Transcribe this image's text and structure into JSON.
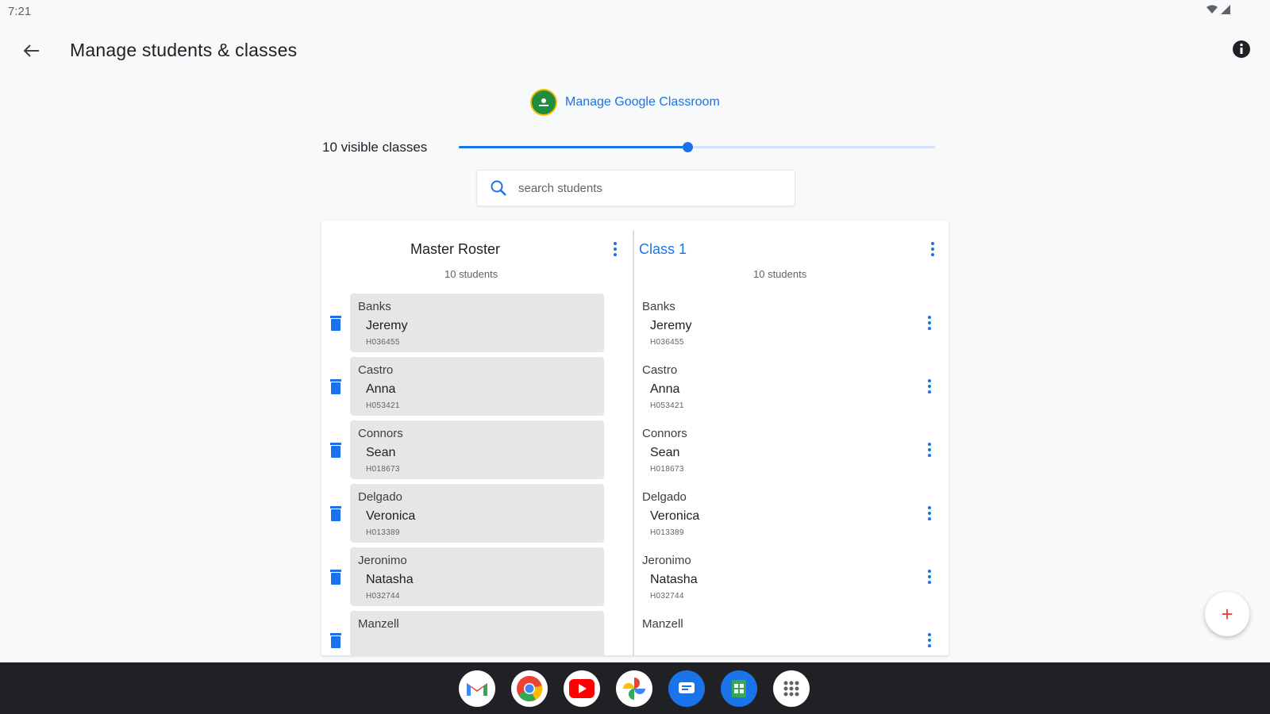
{
  "status_bar": {
    "time": "7:21"
  },
  "app_bar": {
    "title": "Manage students & classes"
  },
  "google_classroom": {
    "link_label": "Manage Google Classroom"
  },
  "visible_classes": {
    "label": "10 visible classes",
    "slider_fraction": 0.48
  },
  "search": {
    "placeholder": "search students",
    "value": ""
  },
  "master_roster": {
    "title": "Master Roster",
    "count": "10 students",
    "students": [
      {
        "last": "Banks",
        "first": "Jeremy",
        "id": "H036455"
      },
      {
        "last": "Castro",
        "first": "Anna",
        "id": "H053421"
      },
      {
        "last": "Connors",
        "first": "Sean",
        "id": "H018673"
      },
      {
        "last": "Delgado",
        "first": "Veronica",
        "id": "H013389"
      },
      {
        "last": "Jeronimo",
        "first": "Natasha",
        "id": "H032744"
      },
      {
        "last": "Manzell",
        "first": "",
        "id": ""
      }
    ]
  },
  "class_column": {
    "title": "Class 1",
    "count": "10 students",
    "students": [
      {
        "last": "Banks",
        "first": "Jeremy",
        "id": "H036455"
      },
      {
        "last": "Castro",
        "first": "Anna",
        "id": "H053421"
      },
      {
        "last": "Connors",
        "first": "Sean",
        "id": "H018673"
      },
      {
        "last": "Delgado",
        "first": "Veronica",
        "id": "H013389"
      },
      {
        "last": "Jeronimo",
        "first": "Natasha",
        "id": "H032744"
      },
      {
        "last": "Manzell",
        "first": "",
        "id": ""
      }
    ]
  },
  "fab": {
    "label": "+"
  },
  "dock": {
    "apps": [
      "gmail-icon",
      "chrome-icon",
      "youtube-icon",
      "photos-icon",
      "messages-icon",
      "sheets-icon",
      "app-launcher-icon"
    ]
  },
  "colors": {
    "accent": "#1a73e8",
    "card": "#e6e6e6",
    "fab_plus": "#ea4335",
    "taskbar": "#202124"
  }
}
